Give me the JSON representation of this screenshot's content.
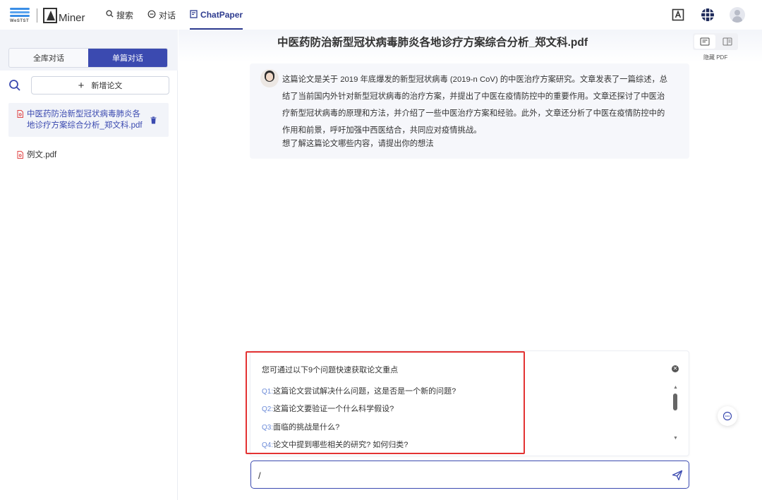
{
  "header": {
    "logo_sub": "WeSTST",
    "logo_text": "Miner",
    "nav": [
      {
        "label": "搜索",
        "icon": "search-icon"
      },
      {
        "label": "对话",
        "icon": "chat-icon"
      },
      {
        "label": "ChatPaper",
        "icon": "document-icon"
      }
    ],
    "right_icons": [
      "translate-icon",
      "apps-grid-icon",
      "user-avatar"
    ]
  },
  "sidebar": {
    "tabs": [
      {
        "label": "全库对话"
      },
      {
        "label": "单篇对话"
      }
    ],
    "add_label": "新增论文",
    "files": [
      {
        "name": "中医药防治新型冠状病毒肺炎各地诊疗方案综合分析_郑文科.pdf"
      },
      {
        "name": "例文.pdf"
      }
    ]
  },
  "main": {
    "title": "中医药防治新型冠状病毒肺炎各地诊疗方案综合分析_郑文科.pdf",
    "hide_pdf": "隐藏 PDF",
    "bot_message": "这篇论文是关于 2019 年底爆发的新型冠状病毒 (2019-n CoV) 的中医治疗方案研究。文章发表了一篇综述，总结了当前国内外针对新型冠状病毒的治疗方案，并提出了中医在疫情防控中的重要作用。文章还探讨了中医治疗新型冠状病毒的原理和方法，并介绍了一些中医治疗方案和经验。此外，文章还分析了中医在疫情防控中的作用和前景，呼吁加强中西医结合，共同应对疫情挑战。",
    "bot_ask": "想了解这篇论文哪些内容，请提出你的想法",
    "questions_head": "您可通过以下9个问题快速获取论文重点",
    "questions": [
      {
        "num": "Q1:",
        "text": "这篇论文尝试解决什么问题，这是否是一个新的问题?"
      },
      {
        "num": "Q2:",
        "text": "这篇论文要验证一个什么科学假设?"
      },
      {
        "num": "Q3:",
        "text": "面临的挑战是什么?"
      },
      {
        "num": "Q4:",
        "text": "论文中提到哪些相关的研究? 如何归类?"
      }
    ],
    "input_value": "/",
    "colors": {
      "accent": "#3b4ab0",
      "highlight": "#e33232",
      "question_num": "#6c8bd8"
    }
  }
}
